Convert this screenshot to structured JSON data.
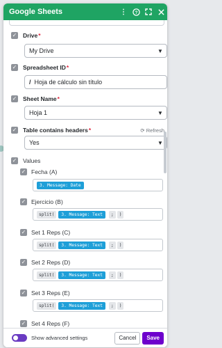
{
  "header": {
    "title": "Google Sheets",
    "icons": [
      "more-vertical-icon",
      "help-icon",
      "expand-icon",
      "close-icon"
    ],
    "background": "#1fa463"
  },
  "fields": {
    "drive": {
      "label": "Drive",
      "required": "*",
      "value": "My Drive"
    },
    "spreadsheet_id": {
      "label": "Spreadsheet ID",
      "required": "*",
      "value": "Hoja de cálculo sin título"
    },
    "sheet_name": {
      "label": "Sheet Name",
      "required": "*",
      "value": "Hoja 1"
    },
    "table_headers": {
      "label": "Table contains headers",
      "required": "*",
      "value": "Yes",
      "refresh_label": "Refresh"
    }
  },
  "values": {
    "label": "Values",
    "columns": [
      {
        "label": "Fecha (A)",
        "pill": "3. Message: Date"
      },
      {
        "label": "Ejercicio (B)",
        "fn": "split(",
        "pill": "3. Message: Text",
        "sep": ";",
        "close": ")"
      },
      {
        "label": "Set 1 Reps (C)",
        "fn": "split(",
        "pill": "3. Message: Text",
        "sep": ";",
        "close": ")"
      },
      {
        "label": "Set 2 Reps (D)",
        "fn": "split(",
        "pill": "3. Message: Text",
        "sep": ";",
        "close": ")"
      },
      {
        "label": "Set 3 Reps (E)",
        "fn": "split(",
        "pill": "3. Message: Text",
        "sep": ";",
        "close": ")"
      },
      {
        "label": "Set 4 Reps (F)"
      }
    ]
  },
  "footer": {
    "toggle_label": "Show advanced settings",
    "cancel_label": "Cancel",
    "save_label": "Save"
  },
  "colors": {
    "accent": "#6d00cc",
    "pill": "#1e9fd8",
    "required": "#e0273f"
  }
}
